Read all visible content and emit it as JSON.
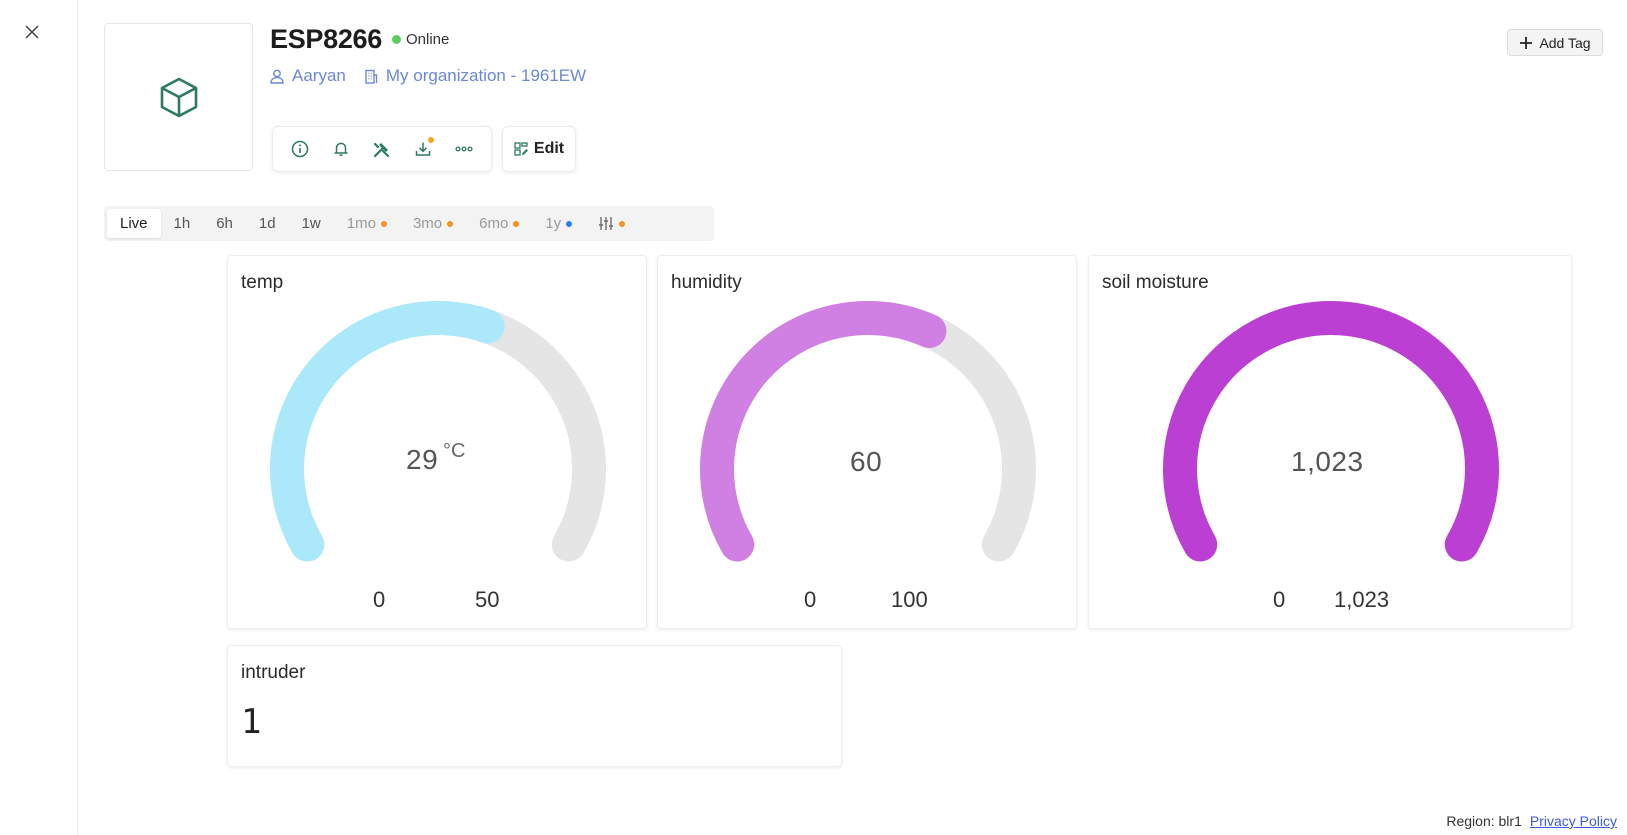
{
  "device": {
    "name": "ESP8266",
    "status": "Online",
    "owner": "Aaryan",
    "organization": "My organization - 1961EW"
  },
  "actions": {
    "edit_label": "Edit",
    "add_tag_label": "Add Tag"
  },
  "time_tabs": [
    {
      "label": "Live",
      "active": true
    },
    {
      "label": "1h"
    },
    {
      "label": "6h"
    },
    {
      "label": "1d"
    },
    {
      "label": "1w"
    },
    {
      "label": "1mo",
      "dot": "#f5921e"
    },
    {
      "label": "3mo",
      "dot": "#f5921e"
    },
    {
      "label": "6mo",
      "dot": "#f5921e"
    },
    {
      "label": "1y",
      "dot": "#2f7cf6"
    }
  ],
  "widgets": {
    "temp": {
      "title": "temp",
      "value": "29",
      "unit": "°C",
      "min": "0",
      "max": "50",
      "fraction": 0.58,
      "color": "#aae8fa"
    },
    "humidity": {
      "title": "humidity",
      "value": "60",
      "min": "0",
      "max": "100",
      "fraction": 0.6,
      "color": "#d07fe2"
    },
    "soil": {
      "title": "soil moisture",
      "value": "1,023",
      "min": "0",
      "max": "1,023",
      "fraction": 1.0,
      "color": "#bb3fd3"
    },
    "intruder": {
      "title": "intruder",
      "value": "1"
    }
  },
  "footer": {
    "region": "Region: blr1",
    "privacy": "Privacy Policy"
  },
  "colors": {
    "accent_green": "#2b7a62",
    "link_blue": "#6b88d8",
    "gauge_track": "#e5e5e5",
    "online": "#5ccd5c"
  }
}
